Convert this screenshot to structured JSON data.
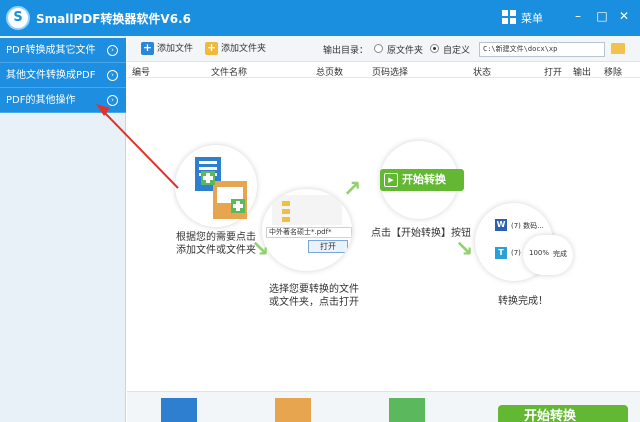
{
  "window": {
    "title": "SmallPDF转换器软件V6.6",
    "menu_label": "菜单",
    "logo_letter": "S"
  },
  "sidebar": {
    "items": [
      {
        "label": "PDF转换成其它文件"
      },
      {
        "label": "其他文件转换成PDF"
      },
      {
        "label": "PDF的其他操作"
      }
    ]
  },
  "toolbar": {
    "add_file": "添加文件",
    "add_folder": "添加文件夹",
    "output_label": "输出目录：",
    "option_original": "原文件夹",
    "option_custom": "自定义",
    "path_value": "C:\\新建文件\\docx\\xp",
    "selected_option": "custom"
  },
  "table": {
    "headers": [
      "编号",
      "文件名称",
      "总页数",
      "页码选择",
      "状态",
      "打开",
      "输出",
      "移除"
    ]
  },
  "guide": {
    "step1_caption_l1": "根据您的需要点击",
    "step1_caption_l2": "添加文件或文件夹",
    "step2_caption_l1": "选择您要转换的文件",
    "step2_caption_l2": "或文件夹，点击打开",
    "step2_file_text": "中外著名硕士*.pdf*",
    "step2_open_button": "打开",
    "step3_button": "开始转换",
    "step3_caption": "点击【开始转换】按钮",
    "step4_row1": "(7) 数码...",
    "step4_row2": "(7)",
    "step4_percent": "100%",
    "step4_done": "完成",
    "step4_caption": "转换完成！"
  },
  "bottom": {
    "start_button": "开始转换"
  },
  "colors": {
    "brand_blue": "#1a8fdf",
    "sidebar_blue": "#1e8ee0",
    "accent_green": "#62b832",
    "arrow_red": "#e0322b"
  }
}
